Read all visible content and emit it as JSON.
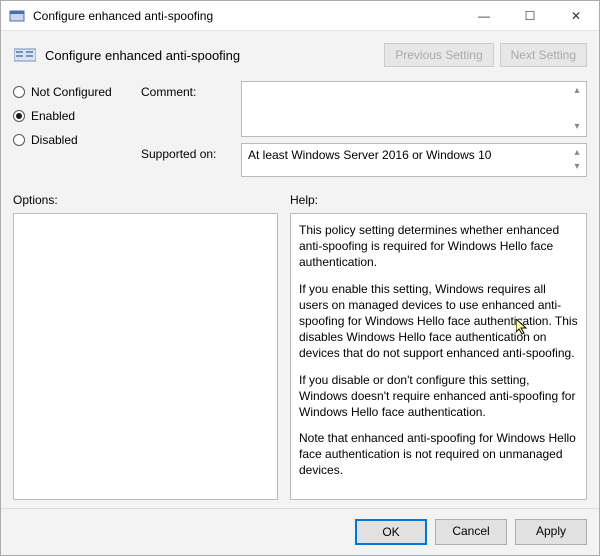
{
  "window": {
    "title": "Configure enhanced anti-spoofing",
    "minimize_glyph": "—",
    "maximize_glyph": "☐",
    "close_glyph": "✕"
  },
  "header": {
    "title": "Configure enhanced anti-spoofing",
    "prev_label": "Previous Setting",
    "next_label": "Next Setting"
  },
  "radios": {
    "not_configured": "Not Configured",
    "enabled": "Enabled",
    "disabled": "Disabled",
    "selected": "enabled"
  },
  "comment": {
    "label": "Comment:",
    "value": ""
  },
  "supported": {
    "label": "Supported on:",
    "value": "At least Windows Server 2016 or Windows 10"
  },
  "options": {
    "label": "Options:"
  },
  "help": {
    "label": "Help:",
    "p1": "This policy setting determines whether enhanced anti-spoofing is required for Windows Hello face authentication.",
    "p2": "If you enable this setting, Windows requires all users on managed devices to use enhanced anti-spoofing for Windows Hello face authentication. This disables Windows Hello face authentication on devices that do not support enhanced anti-spoofing.",
    "p3": "If you disable or don't configure this setting, Windows doesn't require enhanced anti-spoofing for Windows Hello face authentication.",
    "p4": "Note that enhanced anti-spoofing for Windows Hello face authentication is not required on unmanaged devices."
  },
  "footer": {
    "ok": "OK",
    "cancel": "Cancel",
    "apply": "Apply"
  }
}
